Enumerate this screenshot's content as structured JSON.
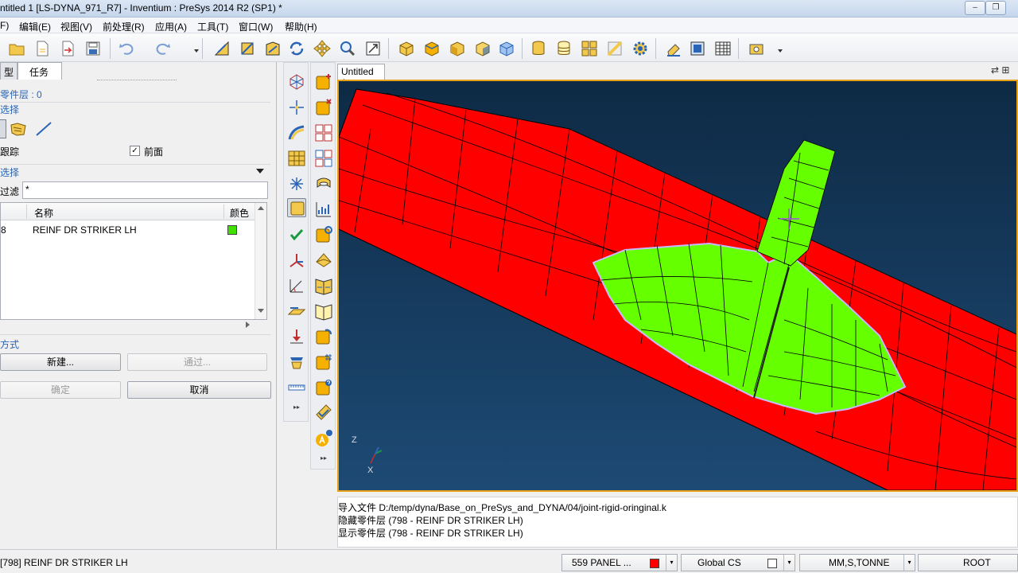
{
  "window": {
    "title": "ntitled 1 [LS-DYNA_971_R7] - Inventium : PreSys 2014 R2 (SP1) *",
    "btn_min": "–",
    "btn_max": "❐"
  },
  "menu": [
    "F)",
    "编辑(E)",
    "视图(V)",
    "前处理(R)",
    "应用(A)",
    "工具(T)",
    "窗口(W)",
    "帮助(H)"
  ],
  "panel": {
    "tabs": [
      "型",
      "任务"
    ],
    "part_layer": "零件层 : 0",
    "select_header": "选择",
    "track_label": "跟踪",
    "front_label": "前面",
    "front_checked": "✓",
    "filter_header": "选择",
    "filter_label": "过滤",
    "filter_value": "*",
    "columns": {
      "id": "",
      "name": "名称",
      "color": "颜色"
    },
    "rows": [
      {
        "id": "8",
        "name": "REINF DR STRIKER LH",
        "color": "#40e000"
      }
    ],
    "method_header": "方式",
    "btn_new": "新建...",
    "btn_through": "通过...",
    "btn_ok": "确定",
    "btn_cancel": "取消"
  },
  "viewport": {
    "tab": "Untitled 1",
    "tab_icons": "⇄ ⊞",
    "triad_z": "Z",
    "triad_x": "X",
    "colors": {
      "background": "#1c4466",
      "panel": "#ff0000",
      "part": "#66ff00"
    }
  },
  "console": [
    "导入文件 D:/temp/dyna/Base_on_PreSys_and_DYNA/04/joint-rigid-oringinal.k",
    "隐藏零件层 (798 - REINF DR STRIKER LH)",
    "显示零件层 (798 - REINF DR STRIKER LH)"
  ],
  "status": {
    "selection": "[798] REINF DR STRIKER LH",
    "part": "559  PANEL ...",
    "part_color": "#ff0000",
    "cs": "Global CS",
    "units": "MM,S,TONNE",
    "root": "ROOT"
  }
}
